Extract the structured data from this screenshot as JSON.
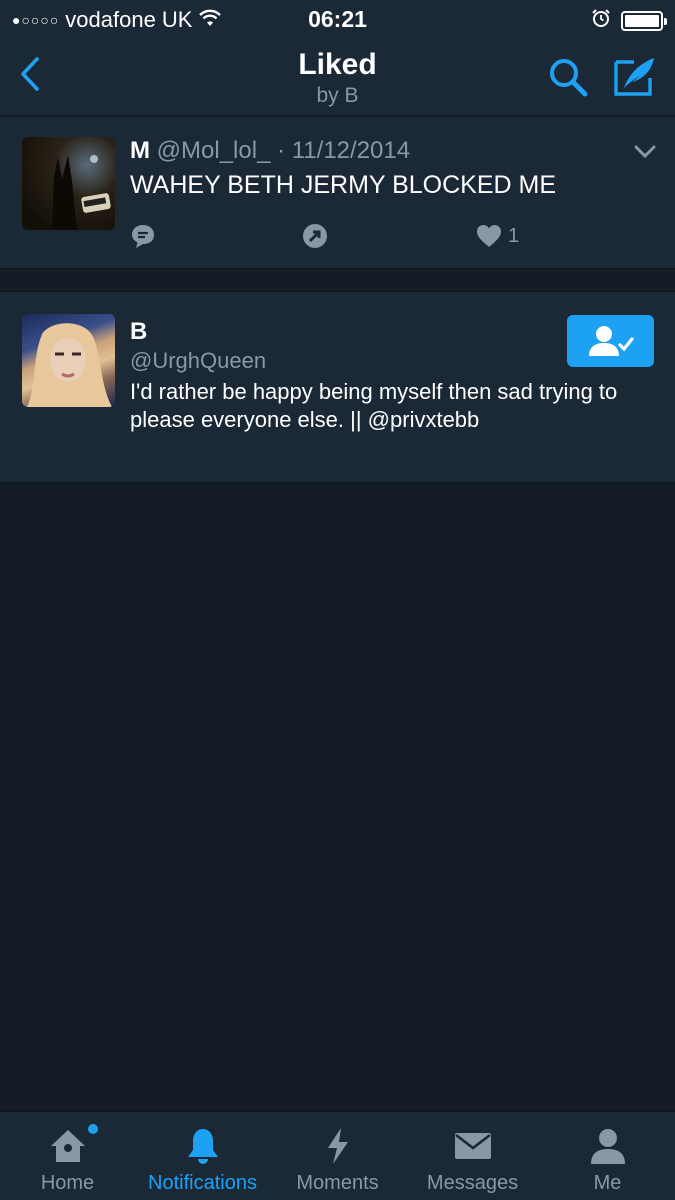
{
  "status_bar": {
    "signal": "●○○○○",
    "carrier": "vodafone UK",
    "time": "06:21"
  },
  "navbar": {
    "title": "Liked",
    "subtitle": "by B"
  },
  "tweet": {
    "name": "M",
    "handle_date": "@Mol_lol_ · 11/12/2014",
    "text": "WAHEY BETH JERMY BLOCKED ME",
    "like_count": "1"
  },
  "user": {
    "name": "B",
    "handle": "@UrghQueen",
    "bio": "I'd rather be happy being myself then sad trying to please everyone else. || @privxtebb"
  },
  "tabs": [
    {
      "label": "Home",
      "icon": "home-icon"
    },
    {
      "label": "Notifications",
      "icon": "bell-icon"
    },
    {
      "label": "Moments",
      "icon": "lightning-icon"
    },
    {
      "label": "Messages",
      "icon": "envelope-icon"
    },
    {
      "label": "Me",
      "icon": "person-icon"
    }
  ],
  "colors": {
    "accent": "#1da1f2",
    "background": "#141d26",
    "card": "#1b2836",
    "muted": "#8899a6"
  }
}
